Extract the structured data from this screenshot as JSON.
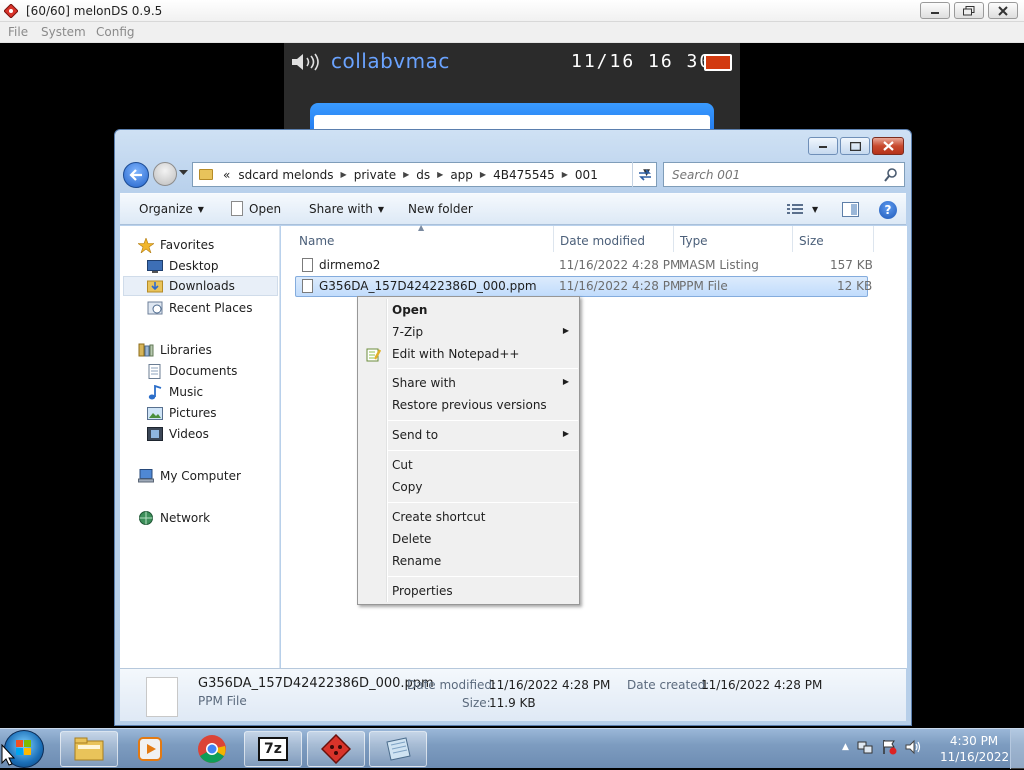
{
  "emulator": {
    "title": "[60/60] melonDS 0.9.5",
    "menu": [
      "File",
      "System",
      "Config"
    ],
    "ds_screen": {
      "username": "collabvmac",
      "datetime": "11/16  16 30",
      "battery_color": "#d23a10"
    }
  },
  "explorer": {
    "address_crumbs": [
      "«",
      "sdcard melonds",
      "private",
      "ds",
      "app",
      "4B475545",
      "001"
    ],
    "search_placeholder": "Search 001",
    "toolbar": {
      "organize": "Organize",
      "open": "Open",
      "share_with": "Share with",
      "new_folder": "New folder"
    },
    "nav": {
      "favorites": "Favorites",
      "desktop": "Desktop",
      "downloads": "Downloads",
      "recent_places": "Recent Places",
      "libraries": "Libraries",
      "documents": "Documents",
      "music": "Music",
      "pictures": "Pictures",
      "videos": "Videos",
      "my_computer": "My Computer",
      "network": "Network"
    },
    "columns": {
      "name": "Name",
      "date_modified": "Date modified",
      "type": "Type",
      "size": "Size"
    },
    "files": [
      {
        "name": "dirmemo2",
        "date": "11/16/2022 4:28 PM",
        "type": "MASM Listing",
        "size": "157 KB"
      },
      {
        "name": "G356DA_157D42422386D_000.ppm",
        "date": "11/16/2022 4:28 PM",
        "type": "PPM File",
        "size": "12 KB"
      }
    ],
    "details": {
      "filename": "G356DA_157D42422386D_000.ppm",
      "filetype": "PPM File",
      "date_modified_label": "Date modified:",
      "date_modified": "11/16/2022 4:28 PM",
      "date_created_label": "Date created:",
      "date_created": "11/16/2022 4:28 PM",
      "size_label": "Size:",
      "size": "11.9 KB"
    }
  },
  "context_menu": {
    "open": "Open",
    "seven_zip": "7-Zip",
    "edit_notepad": "Edit with Notepad++",
    "share_with": "Share with",
    "restore": "Restore previous versions",
    "send_to": "Send to",
    "cut": "Cut",
    "copy": "Copy",
    "create_shortcut": "Create shortcut",
    "delete": "Delete",
    "rename": "Rename",
    "properties": "Properties"
  },
  "taskbar": {
    "time": "4:30 PM",
    "date": "11/16/2022",
    "sevenzip_label": "7z"
  }
}
